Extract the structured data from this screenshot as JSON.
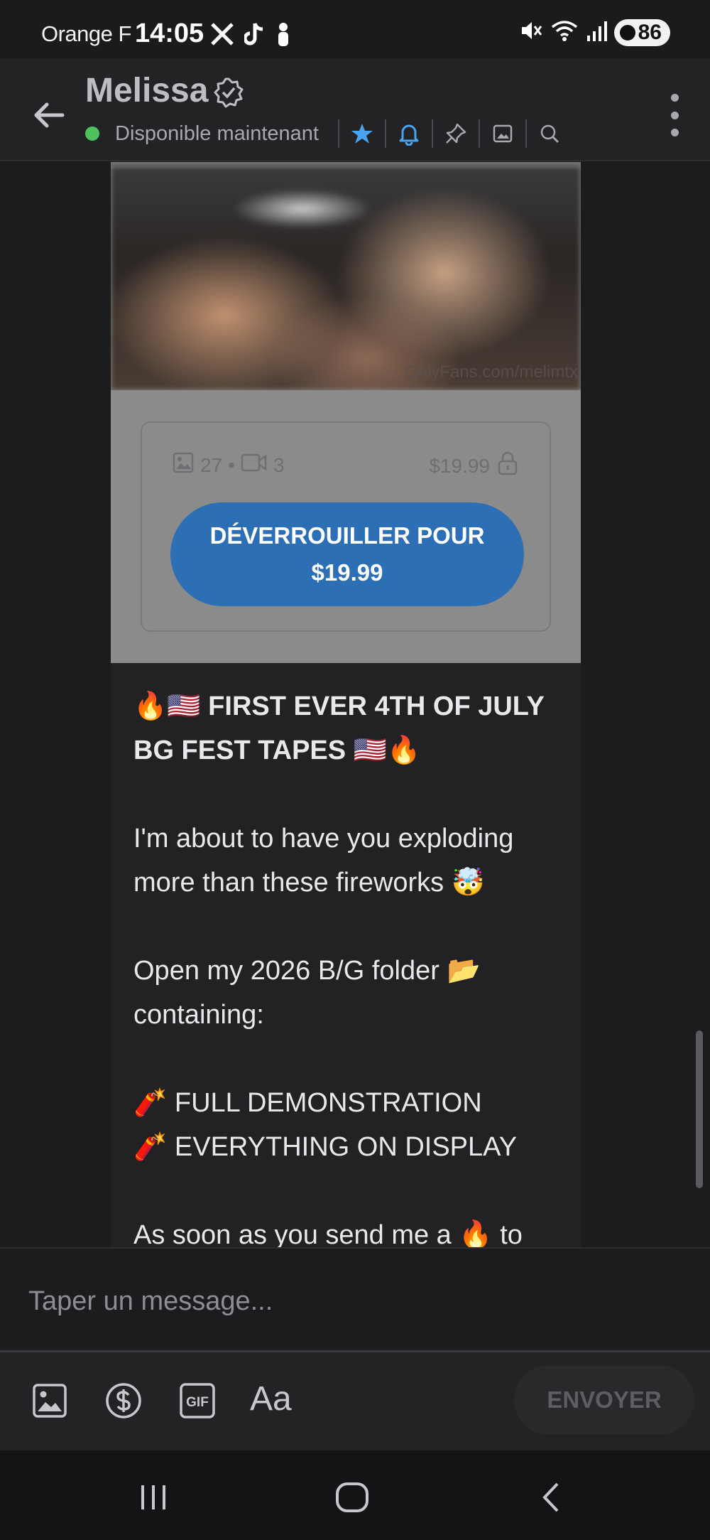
{
  "status_bar": {
    "carrier": "Orange F",
    "time": "14:05",
    "battery": "86",
    "icons_left": [
      "x-logo-icon",
      "tiktok-icon",
      "person-icon"
    ],
    "icons_right": [
      "mute-icon",
      "wifi-icon",
      "signal-icon"
    ]
  },
  "header": {
    "name": "Melissa",
    "status": "Disponible maintenant",
    "online_color": "#4fc25b",
    "star_color": "#4aa3ee",
    "actions": [
      "star-icon",
      "bell-icon",
      "pin-icon",
      "gallery-icon",
      "search-icon"
    ]
  },
  "media": {
    "watermark": "OnlyFans.com/melimtx",
    "photo_count": "27",
    "separator": "•",
    "video_count": "3",
    "price": "$19.99",
    "unlock_line1": "DÉVERROUILLER POUR",
    "unlock_line2": "$19.99",
    "button_color": "#2d6fb4"
  },
  "message": {
    "title_line1": "🔥🇺🇸 FIRST EVER 4TH OF JULY",
    "title_line2": "BG FEST TAPES 🇺🇸🔥",
    "para1_line1": "I'm about to have you exploding",
    "para1_line2": "more than these fireworks 🤯",
    "para2_line1": "Open my 2026 B/G folder 📂",
    "para2_line2": "containing:",
    "item1": "🧨 FULL DEMONSTRATION",
    "item2": "🧨 EVERYTHING ON DISPLAY",
    "para3_line1": "As soon as you send me a 🔥 to"
  },
  "composer": {
    "placeholder": "Taper un message...",
    "font_label": "Aa",
    "send_label": "ENVOYER",
    "tools": [
      "image-icon",
      "dollar-icon",
      "gif-icon"
    ]
  },
  "navbar": {
    "buttons": [
      "recents-icon",
      "home-icon",
      "back-icon"
    ]
  }
}
